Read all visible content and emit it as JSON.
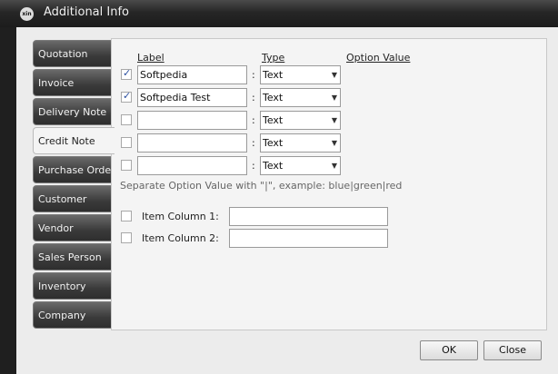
{
  "window": {
    "title": "Additional Info",
    "icon_text": "xin"
  },
  "tabs": [
    {
      "label": "Quotation"
    },
    {
      "label": "Invoice"
    },
    {
      "label": "Delivery Note"
    },
    {
      "label": "Credit Note",
      "active": true
    },
    {
      "label": "Purchase Order"
    },
    {
      "label": "Customer"
    },
    {
      "label": "Vendor"
    },
    {
      "label": "Sales Person"
    },
    {
      "label": "Inventory"
    },
    {
      "label": "Company"
    }
  ],
  "headers": {
    "label": "Label",
    "type": "Type",
    "option_value": "Option Value"
  },
  "rows": [
    {
      "checked": true,
      "label": "Softpedia",
      "type": "Text"
    },
    {
      "checked": true,
      "label": "Softpedia Test",
      "type": "Text"
    },
    {
      "checked": false,
      "label": "",
      "type": "Text"
    },
    {
      "checked": false,
      "label": "",
      "type": "Text"
    },
    {
      "checked": false,
      "label": "",
      "type": "Text"
    }
  ],
  "separator": ":",
  "hint": "Separate Option Value with \"|\", example: blue|green|red",
  "item_columns": [
    {
      "checked": false,
      "label": "Item Column 1:",
      "value": ""
    },
    {
      "checked": false,
      "label": "Item Column 2:",
      "value": ""
    }
  ],
  "buttons": {
    "ok": "OK",
    "close": "Close"
  }
}
